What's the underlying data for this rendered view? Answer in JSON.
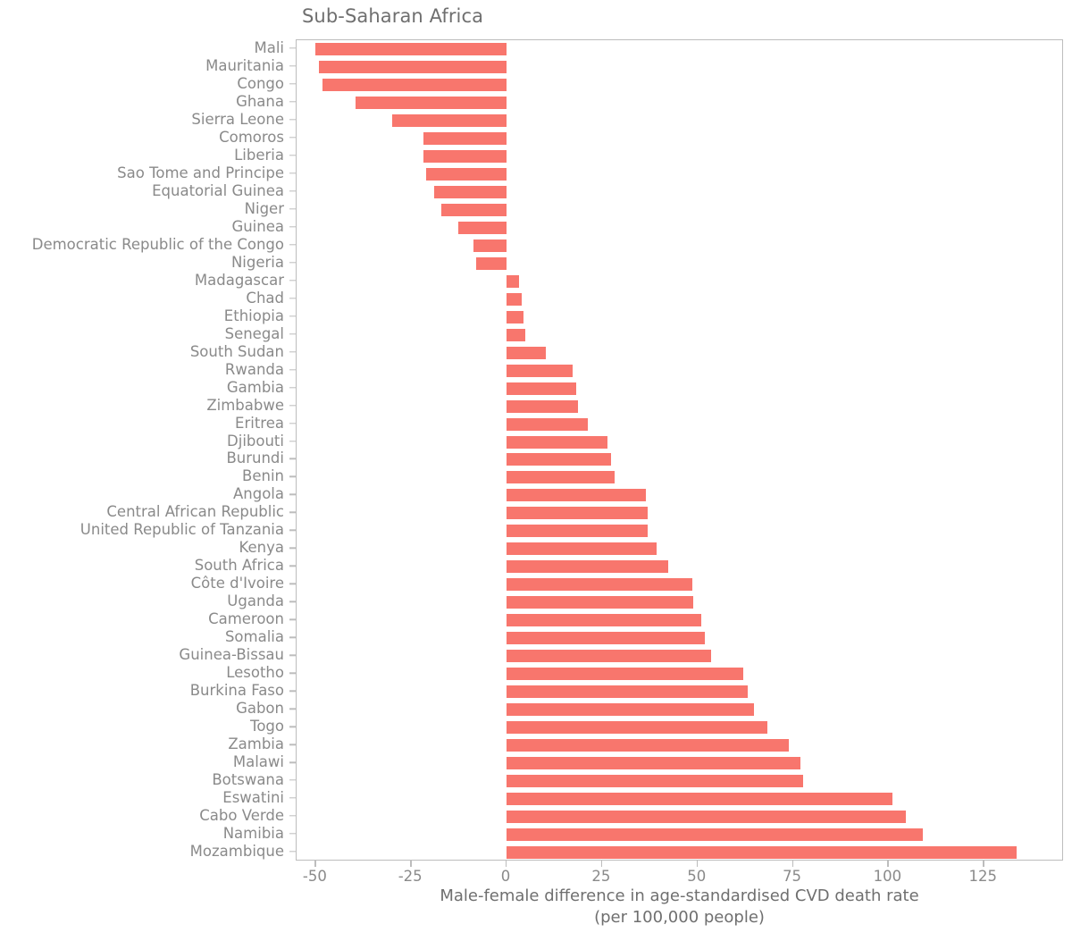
{
  "title": "Sub-Saharan Africa",
  "axis": {
    "x_title_line1": "Male-female difference in age-standardised CVD death rate",
    "x_title_line2": "(per 100,000 people)",
    "y_title": ""
  },
  "colors": {
    "bar": "#f8766d",
    "text": "#8a8a8a",
    "title_text": "#6f6f6f",
    "axis_line": "#bdbdbd",
    "background": "#ffffff"
  },
  "chart_data": {
    "type": "bar",
    "orientation": "horizontal",
    "title": "Sub-Saharan Africa",
    "xlabel": "Male-female difference in age-standardised CVD death rate (per 100,000 people)",
    "ylabel": "",
    "xlim": [
      -55,
      146
    ],
    "xticks": [
      -50,
      -25,
      0,
      25,
      50,
      75,
      100,
      125
    ],
    "grid": false,
    "legend": null,
    "categories": [
      "Mali",
      "Mauritania",
      "Congo",
      "Ghana",
      "Sierra Leone",
      "Comoros",
      "Liberia",
      "Sao Tome and Principe",
      "Equatorial Guinea",
      "Niger",
      "Guinea",
      "Democratic Republic of the Congo",
      "Nigeria",
      "Madagascar",
      "Chad",
      "Ethiopia",
      "Senegal",
      "South Sudan",
      "Rwanda",
      "Gambia",
      "Zimbabwe",
      "Eritrea",
      "Djibouti",
      "Burundi",
      "Benin",
      "Angola",
      "Central African Republic",
      "United Republic of Tanzania",
      "Kenya",
      "South Africa",
      "Côte d'Ivoire",
      "Uganda",
      "Cameroon",
      "Somalia",
      "Guinea-Bissau",
      "Lesotho",
      "Burkina Faso",
      "Gabon",
      "Togo",
      "Zambia",
      "Malawi",
      "Botswana",
      "Eswatini",
      "Cabo Verde",
      "Namibia",
      "Mozambique"
    ],
    "values": [
      -50.0,
      -49.2,
      -48.3,
      -39.5,
      -30.0,
      -21.7,
      -21.7,
      -21.0,
      -19.0,
      -17.0,
      -12.6,
      -8.6,
      -7.9,
      3.3,
      4.0,
      4.5,
      4.8,
      10.2,
      17.3,
      18.2,
      18.6,
      21.2,
      26.5,
      27.4,
      28.3,
      36.4,
      37.0,
      37.0,
      39.3,
      42.3,
      48.6,
      48.8,
      51.0,
      52.0,
      53.6,
      62.0,
      63.2,
      64.7,
      68.4,
      74.0,
      77.0,
      77.6,
      101.0,
      104.5,
      109.0,
      133.5
    ]
  }
}
